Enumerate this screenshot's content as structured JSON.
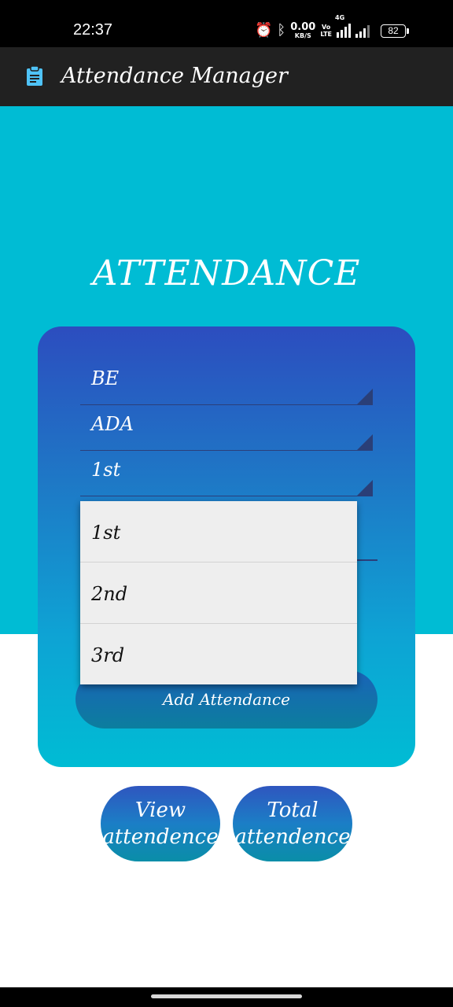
{
  "status_bar": {
    "time": "22:37",
    "net_speed_value": "0.00",
    "net_speed_unit": "KB/S",
    "volte_top": "Vo",
    "volte_bottom": "LTE",
    "network_type": "4G",
    "battery": "82"
  },
  "app_bar": {
    "title": "Attendance Manager",
    "icon": "clipboard-icon"
  },
  "main": {
    "heading": "ATTENDANCE",
    "spinners": [
      {
        "value": "BE"
      },
      {
        "value": "ADA"
      },
      {
        "value": "1st"
      }
    ],
    "dropdown_options": [
      "1st",
      "2nd",
      "3rd"
    ],
    "add_button_label": "Add Attendance",
    "view_button_line1": "View",
    "view_button_line2": "attendence",
    "total_button_line1": "Total",
    "total_button_line2": "attendence"
  },
  "colors": {
    "primary_bg": "#00bcd4",
    "app_bar": "#212121",
    "card_gradient_top": "#2c4dbf",
    "card_gradient_bottom": "#00bcd4",
    "dropdown_bg": "#eeeeee"
  }
}
